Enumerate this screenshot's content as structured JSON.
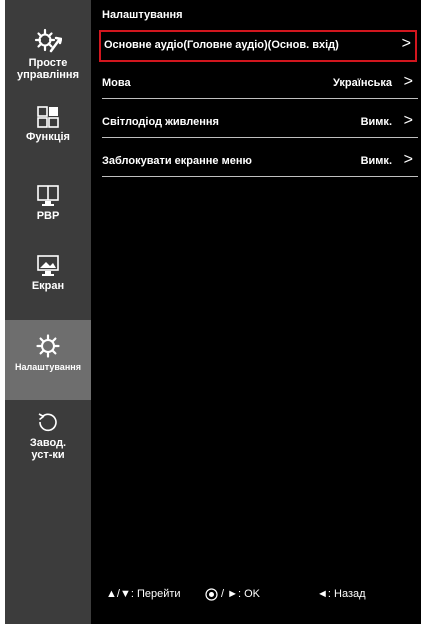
{
  "sidebar": {
    "items": [
      {
        "label": "Просте управління",
        "icon": "gear-wrench-icon"
      },
      {
        "label": "Функція",
        "icon": "layout-grid-icon"
      },
      {
        "label": "PBP",
        "icon": "pbp-monitor-icon"
      },
      {
        "label": "Екран",
        "icon": "picture-monitor-icon"
      },
      {
        "label": "Налаштування",
        "icon": "gear-icon",
        "selected": true
      },
      {
        "label": "Завод. уст-ки",
        "icon": "reset-icon"
      }
    ]
  },
  "main": {
    "title": "Налаштування",
    "rows": [
      {
        "label": "Основне аудіо(Головне аудіо)(Основ. вхід)",
        "value": "",
        "arrow": ">",
        "selected": true
      },
      {
        "label": "Мова",
        "value": "Українська",
        "arrow": ">"
      },
      {
        "label": "Світлодіод живлення",
        "value": "Вимк.",
        "arrow": ">"
      },
      {
        "label": "Заблокувати екранне меню",
        "value": "Вимк.",
        "arrow": ">"
      }
    ]
  },
  "footer": {
    "move": "▲/▼: Перейти",
    "ok": "/ ►: OK",
    "back": "◄: Назад"
  },
  "colors": {
    "background": "#000000",
    "sidebar": "#3c3c3c",
    "sidebar_selected": "#6e6e6e",
    "selection_border": "#d2161e"
  }
}
